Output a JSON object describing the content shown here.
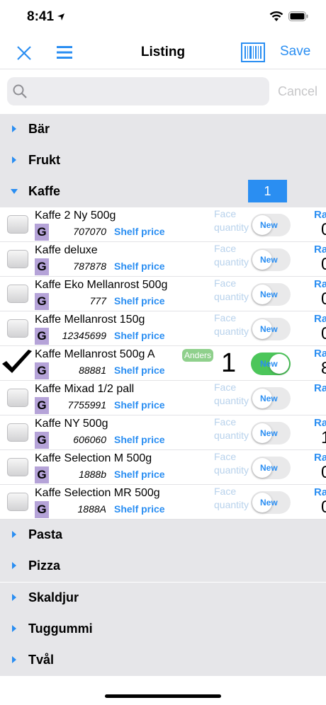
{
  "status": {
    "time": "8:41"
  },
  "nav": {
    "title": "Listing",
    "save_label": "Save"
  },
  "search": {
    "placeholder": "",
    "cancel_label": "Cancel"
  },
  "categories_top": [
    {
      "label": "Bär",
      "expanded": false
    },
    {
      "label": "Frukt",
      "expanded": false
    },
    {
      "label": "Kaffe",
      "expanded": true,
      "count": "1"
    }
  ],
  "products": [
    {
      "name": "Kaffe 2 Ny 500g",
      "group": "G",
      "code": "707070",
      "shelf": "Shelf price",
      "face": "Face quantity",
      "toggle_label": "New",
      "toggle_on": false,
      "checked": false,
      "ra": "Ra",
      "rnum": "0"
    },
    {
      "name": "Kaffe deluxe",
      "group": "G",
      "code": "787878",
      "shelf": "Shelf price",
      "face": "Face quantity",
      "toggle_label": "New",
      "toggle_on": false,
      "checked": false,
      "ra": "Ra",
      "rnum": "0"
    },
    {
      "name": "Kaffe Eko Mellanrost 500g",
      "group": "G",
      "code": "777",
      "shelf": "Shelf price",
      "face": "Face quantity",
      "toggle_label": "New",
      "toggle_on": false,
      "checked": false,
      "ra": "Ra",
      "rnum": "0"
    },
    {
      "name": "Kaffe Mellanrost 150g",
      "group": "G",
      "code": "12345699",
      "shelf": "Shelf price",
      "face": "Face quantity",
      "toggle_label": "New",
      "toggle_on": false,
      "checked": false,
      "ra": "Ra",
      "rnum": "0"
    },
    {
      "name": "Kaffe Mellanrost 500g A",
      "group": "G",
      "code": "88881",
      "shelf": "Shelf price",
      "quantity": "1",
      "badge": "Anders",
      "toggle_label": "New",
      "toggle_on": true,
      "checked": true,
      "ra": "Ra",
      "rnum": "8"
    },
    {
      "name": "Kaffe Mixad 1/2 pall",
      "group": "G",
      "code": "7755991",
      "shelf": "Shelf price",
      "face": "Face quantity",
      "toggle_label": "New",
      "toggle_on": false,
      "checked": false,
      "ra": "Ra",
      "rnum": ""
    },
    {
      "name": "Kaffe NY 500g",
      "group": "G",
      "code": "606060",
      "shelf": "Shelf price",
      "face": "Face quantity",
      "toggle_label": "New",
      "toggle_on": false,
      "checked": false,
      "ra": "Ra",
      "rnum": "1"
    },
    {
      "name": "Kaffe Selection M 500g",
      "group": "G",
      "code": "1888b",
      "shelf": "Shelf price",
      "face": "Face quantity",
      "toggle_label": "New",
      "toggle_on": false,
      "checked": false,
      "ra": "Ra",
      "rnum": "0"
    },
    {
      "name": "Kaffe Selection MR 500g",
      "group": "G",
      "code": "1888A",
      "shelf": "Shelf price",
      "face": "Face quantity",
      "toggle_label": "New",
      "toggle_on": false,
      "checked": false,
      "ra": "Ra",
      "rnum": "0"
    }
  ],
  "categories_bottom": [
    {
      "label": "Pasta"
    },
    {
      "label": "Pizza"
    },
    {
      "label": "Skaldjur"
    },
    {
      "label": "Tuggummi"
    },
    {
      "label": "Tvål"
    }
  ],
  "colors": {
    "accent": "#2a8ef2",
    "group_badge": "#b5a3d8",
    "toggle_on": "#4cc65a",
    "user_badge": "#8fd08c",
    "section_bg": "#e6e6e9"
  },
  "icons": [
    "location-arrow-icon",
    "wifi-icon",
    "battery-icon",
    "close-icon",
    "menu-icon",
    "barcode-icon",
    "search-icon",
    "chevron-right-icon",
    "chevron-down-icon",
    "checkmark-icon"
  ]
}
